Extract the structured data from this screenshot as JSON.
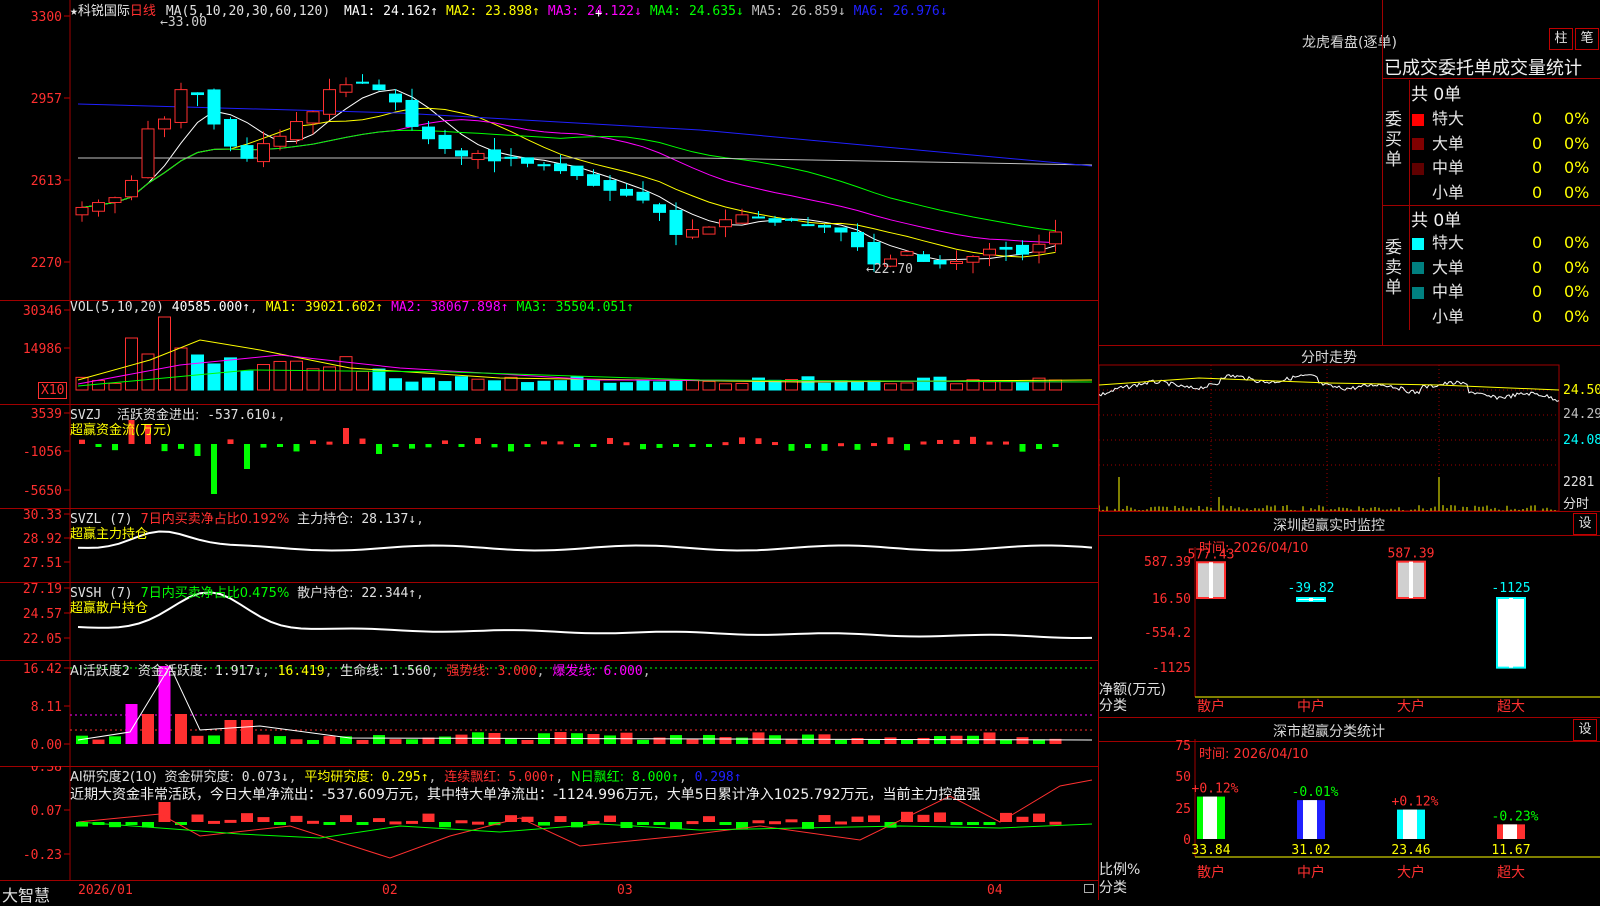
{
  "stock": {
    "title": "★科锐国际",
    "period": "日线",
    "brand": "大智慧"
  },
  "colors": {
    "up": "#ff3030",
    "down": "#00ffff",
    "frame": "#b00000",
    "ma1": "#ffffff",
    "ma2": "#ffff00",
    "ma3": "#ff00ff",
    "ma4": "#00ff00",
    "ma5": "#c0c0c0",
    "ma6": "#2020ff"
  },
  "main": {
    "axis": [
      "3300",
      "2957",
      "2613",
      "2270"
    ],
    "max_label": "33.00",
    "min_label": "22.70",
    "ma_header": "MA(5,10,20,30,60,120)",
    "ma_items": [
      {
        "k": "MA1:",
        "v": "24.162↑"
      },
      {
        "k": "MA2:",
        "v": "23.898↑"
      },
      {
        "k": "MA3:",
        "v": "24.122↓"
      },
      {
        "k": "MA4:",
        "v": "24.635↓"
      },
      {
        "k": "MA5:",
        "v": "26.859↓"
      },
      {
        "k": "MA6:",
        "v": "26.976↓"
      }
    ]
  },
  "vol": {
    "axis": [
      "30346",
      "14986"
    ],
    "unit": "X10",
    "header": "VOL(5,10,20)",
    "value": "40585.000↑",
    "ma_items": [
      {
        "k": "MA1:",
        "v": "39021.602↑"
      },
      {
        "k": "MA2:",
        "v": "38067.898↑"
      },
      {
        "k": "MA3:",
        "v": "35504.051↑"
      }
    ]
  },
  "svzj": {
    "axis": [
      "3539",
      "-1056",
      "-5650"
    ],
    "header": "SVZJ",
    "item": "活跃资金进出:",
    "value": "-537.610↓",
    "sub": "超赢资金流(万元)"
  },
  "svzl": {
    "axis": [
      "30.33",
      "28.92",
      "27.51"
    ],
    "header": "SVZL (7)",
    "ratio": "7日内买卖净占比0.192%",
    "item": "主力持仓:",
    "value": "28.137↓",
    "sub": "超赢主力持仓"
  },
  "svsh": {
    "axis": [
      "27.19",
      "24.57",
      "22.05"
    ],
    "header": "SVSH (7)",
    "ratio": "7日内买卖净占比0.475%",
    "item": "散户持仓:",
    "value": "22.344↑",
    "sub": "超赢散户持仓"
  },
  "ai1": {
    "axis": [
      "16.42",
      "8.11",
      "0.00"
    ],
    "header": "AI活跃度2",
    "item1": "资金活跃度:",
    "v1": "1.917↓",
    "v2": "16.419",
    "item3": "生命线:",
    "v3": "1.560",
    "item4": "强势线:",
    "v4": "3.000",
    "item5": "爆发线:",
    "v5": "6.000"
  },
  "ai2": {
    "axis": [
      "0.38",
      "0.07",
      "-0.23"
    ],
    "header": "AI研究度2(10)",
    "item1": "资金研究度:",
    "v1": "0.073↓",
    "item2": "平均研究度:",
    "v2": "0.295↑",
    "item3": "连续飘红:",
    "v3": "5.000↑",
    "item4": "N日飘红:",
    "v4": "8.000↑",
    "v5": "0.298↑",
    "note": "近期大资金非常活跃，今日大单净流出：-537.609万元，其中特大单净流出：-1124.996万元，大单5日累计净入1025.792万元，当前主力控盘强"
  },
  "dates": [
    "2026/01",
    "02",
    "03",
    "04"
  ],
  "dragon": {
    "title": "龙虎看盘(逐单)",
    "btn1": "柱",
    "btn2": "笔",
    "subtitle": "已成交委托单成交量统计",
    "buy_label": "委买单",
    "sell_label": "委卖单",
    "buy_total": "共 0单",
    "sell_total": "共 0单",
    "rows": [
      {
        "name": "特大",
        "v": "0",
        "p": "0%"
      },
      {
        "name": "大单",
        "v": "0",
        "p": "0%"
      },
      {
        "name": "中单",
        "v": "0",
        "p": "0%"
      },
      {
        "name": "小单",
        "v": "0",
        "p": "0%"
      }
    ]
  },
  "intraday": {
    "title": "分时走势",
    "axis": [
      "24.50",
      "24.29",
      "24.08"
    ],
    "vol_label": "2281",
    "vol_unit": "分时"
  },
  "monitor": {
    "title": "深圳超赢实时监控",
    "btn": "设",
    "time": "时间: 2026/04/10",
    "axis": [
      "587.39",
      "16.50",
      "-554.2",
      "-1125"
    ],
    "ylabel": "净额(万元)",
    "xlabel": "分类",
    "bars": [
      {
        "cat": "散户",
        "label": "577.43",
        "value": 577.43
      },
      {
        "cat": "中户",
        "label": "-39.82",
        "value": -39.82
      },
      {
        "cat": "大户",
        "label": "587.39",
        "value": 587.39
      },
      {
        "cat": "超大",
        "label": "-1125",
        "value": -1125
      }
    ]
  },
  "classify": {
    "title": "深市超赢分类统计",
    "btn": "设",
    "time": "时间: 2026/04/10",
    "axis": [
      "75",
      "50",
      "25",
      "0"
    ],
    "ylabel": "比例%",
    "xlabel": "分类",
    "bars": [
      {
        "cat": "散户",
        "pct": "33.84",
        "chg": "+0.12%",
        "value": 33.84
      },
      {
        "cat": "中户",
        "pct": "31.02",
        "chg": "-0.01%",
        "value": 31.02
      },
      {
        "cat": "大户",
        "pct": "23.46",
        "chg": "+0.12%",
        "value": 23.46
      },
      {
        "cat": "超大",
        "pct": "11.67",
        "chg": "-0.23%",
        "value": 11.67
      }
    ]
  }
}
